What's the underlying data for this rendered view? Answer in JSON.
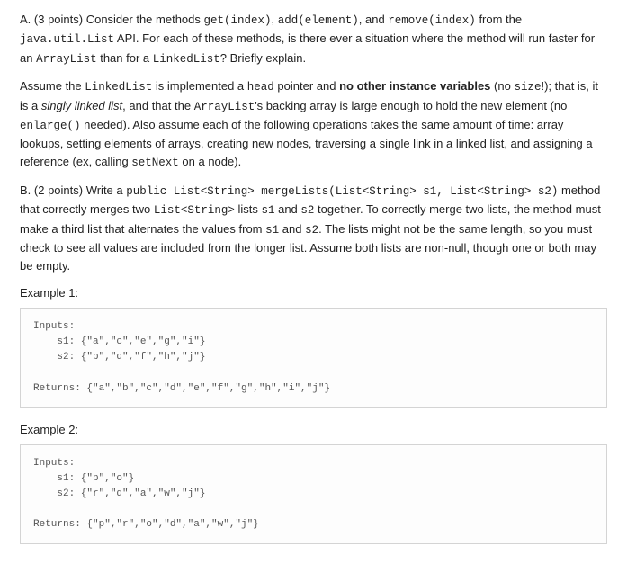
{
  "partA": {
    "p1_lead": "A. (3 points) Consider the methods ",
    "p1_code1": "get(index)",
    "p1_mid1": ", ",
    "p1_code2": "add(element)",
    "p1_mid2": ", and ",
    "p1_code3": "remove(index)",
    "p1_mid3": " from the ",
    "p1_code4": "java.util.List",
    "p1_mid4": " API. For each of these methods, is there ever a situation where the method will run faster for an ",
    "p1_code5": "ArrayList",
    "p1_mid5": " than for a ",
    "p1_code6": "LinkedList",
    "p1_tail": "? Briefly explain.",
    "p2_lead": "Assume the ",
    "p2_code1": "LinkedList",
    "p2_mid1": " is implemented a ",
    "p2_code2": "head",
    "p2_mid2": " pointer and ",
    "p2_bold": "no other instance variables",
    "p2_mid3": " (no ",
    "p2_code3": "size",
    "p2_mid4": "!); that is, it is a ",
    "p2_em": "singly linked list",
    "p2_mid5": ", and that the ",
    "p2_code4": "ArrayList",
    "p2_mid6": "'s backing array is large enough to hold the new element (no ",
    "p2_code5": "enlarge()",
    "p2_mid7": " needed). Also assume each of the following operations takes the same amount of time: array lookups, setting elements of arrays, creating new nodes, traversing a single link in a linked list, and assigning a reference (ex, calling ",
    "p2_code6": "setNext",
    "p2_tail": " on a node)."
  },
  "partB": {
    "lead": "B. (2 points) Write a ",
    "sig": "public List<String> mergeLists(List<String> s1, List<String> s2)",
    "mid1": " method that correctly merges two ",
    "type": "List<String>",
    "mid2": " lists ",
    "s1": "s1",
    "mid3": " and ",
    "s2": "s2",
    "mid4": " together. To correctly merge two lists, the method must make a third list that alternates the values from ",
    "s1b": "s1",
    "mid5": " and ",
    "s2b": "s2",
    "tail": ". The lists might not be the same length, so you must check to see all values are included from the longer list. Assume both lists are non-null, though one or both may be empty."
  },
  "example1": {
    "label": "Example 1:",
    "code": "Inputs:\n    s1: {\"a\",\"c\",\"e\",\"g\",\"i\"}\n    s2: {\"b\",\"d\",\"f\",\"h\",\"j\"}\n\nReturns: {\"a\",\"b\",\"c\",\"d\",\"e\",\"f\",\"g\",\"h\",\"i\",\"j\"}"
  },
  "example2": {
    "label": "Example 2:",
    "code": "Inputs:\n    s1: {\"p\",\"o\"}\n    s2: {\"r\",\"d\",\"a\",\"w\",\"j\"}\n\nReturns: {\"p\",\"r\",\"o\",\"d\",\"a\",\"w\",\"j\"}"
  }
}
